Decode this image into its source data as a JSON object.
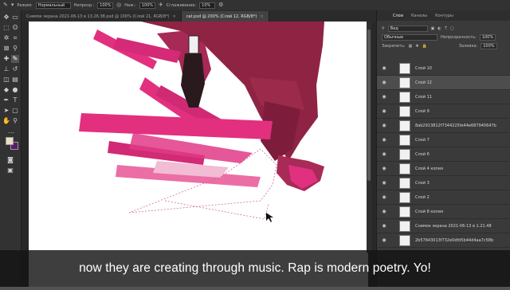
{
  "options_bar": {
    "mode_label": "Режим:",
    "mode_value": "Нормальный",
    "opacity_label": "Непрозр.:",
    "opacity_value": "100%",
    "pressure_label": "Наж.:",
    "pressure_value": "100%",
    "smoothing_label": "Сглаживание:",
    "smoothing_value": "10%"
  },
  "document_tabs": [
    {
      "label": "Снимок экрана 2021-06-13 в 13.26.38.psd @ 100% (Слой 21, RGB/8*)",
      "active": false
    },
    {
      "label": "cat.psd @ 200% (Слой 12, RGB/8*)",
      "active": true
    }
  ],
  "panel": {
    "tabs": [
      "Слои",
      "Каналы",
      "Контуры"
    ],
    "active_tab": "Слои",
    "filter_label": "Вид",
    "blend_mode": "Обычные",
    "opacity_label": "Непрозрачность:",
    "opacity_value": "100%",
    "lock_label": "Закрепить:",
    "fill_label": "Заливка:",
    "fill_value": "100%"
  },
  "layers": [
    {
      "name": "Слой 10",
      "visible": true,
      "selected": false
    },
    {
      "name": "Слой 12",
      "visible": true,
      "selected": true
    },
    {
      "name": "Слой 11",
      "visible": true,
      "selected": false
    },
    {
      "name": "Слой 9",
      "visible": true,
      "selected": false
    },
    {
      "name": "8ab2913812f7344225fe44e687940647b",
      "visible": true,
      "selected": false
    },
    {
      "name": "Слой 7",
      "visible": true,
      "selected": false
    },
    {
      "name": "Слой 6",
      "visible": true,
      "selected": false
    },
    {
      "name": "Слой 4 копия",
      "visible": true,
      "selected": false
    },
    {
      "name": "Слой 3",
      "visible": true,
      "selected": false
    },
    {
      "name": "Слой 2",
      "visible": true,
      "selected": false
    },
    {
      "name": "Слой 8 копия",
      "visible": true,
      "selected": false
    },
    {
      "name": "Снимок экрана 2021-06-13 в 1.21.48",
      "visible": true,
      "selected": false
    },
    {
      "name": "2b57643013f732e0dfd5b44d4aa7c58b",
      "visible": true,
      "selected": false
    }
  ],
  "caption": {
    "text": "now they are creating through music. Rap is modern poetry. Yo!"
  },
  "colors": {
    "foreground": "#e8dfc8",
    "background": "#5b1a6e",
    "accent_pink": "#e2307f",
    "maroon": "#8f2343"
  },
  "icons": [
    "brush-icon",
    "move-icon",
    "marquee-icon",
    "lasso-icon",
    "crop-icon",
    "eyedropper-icon",
    "healing-icon",
    "stamp-icon",
    "eraser-icon",
    "gradient-icon",
    "pen-icon",
    "type-icon",
    "path-select-icon",
    "shape-icon",
    "hand-icon",
    "zoom-icon",
    "eye-icon"
  ]
}
